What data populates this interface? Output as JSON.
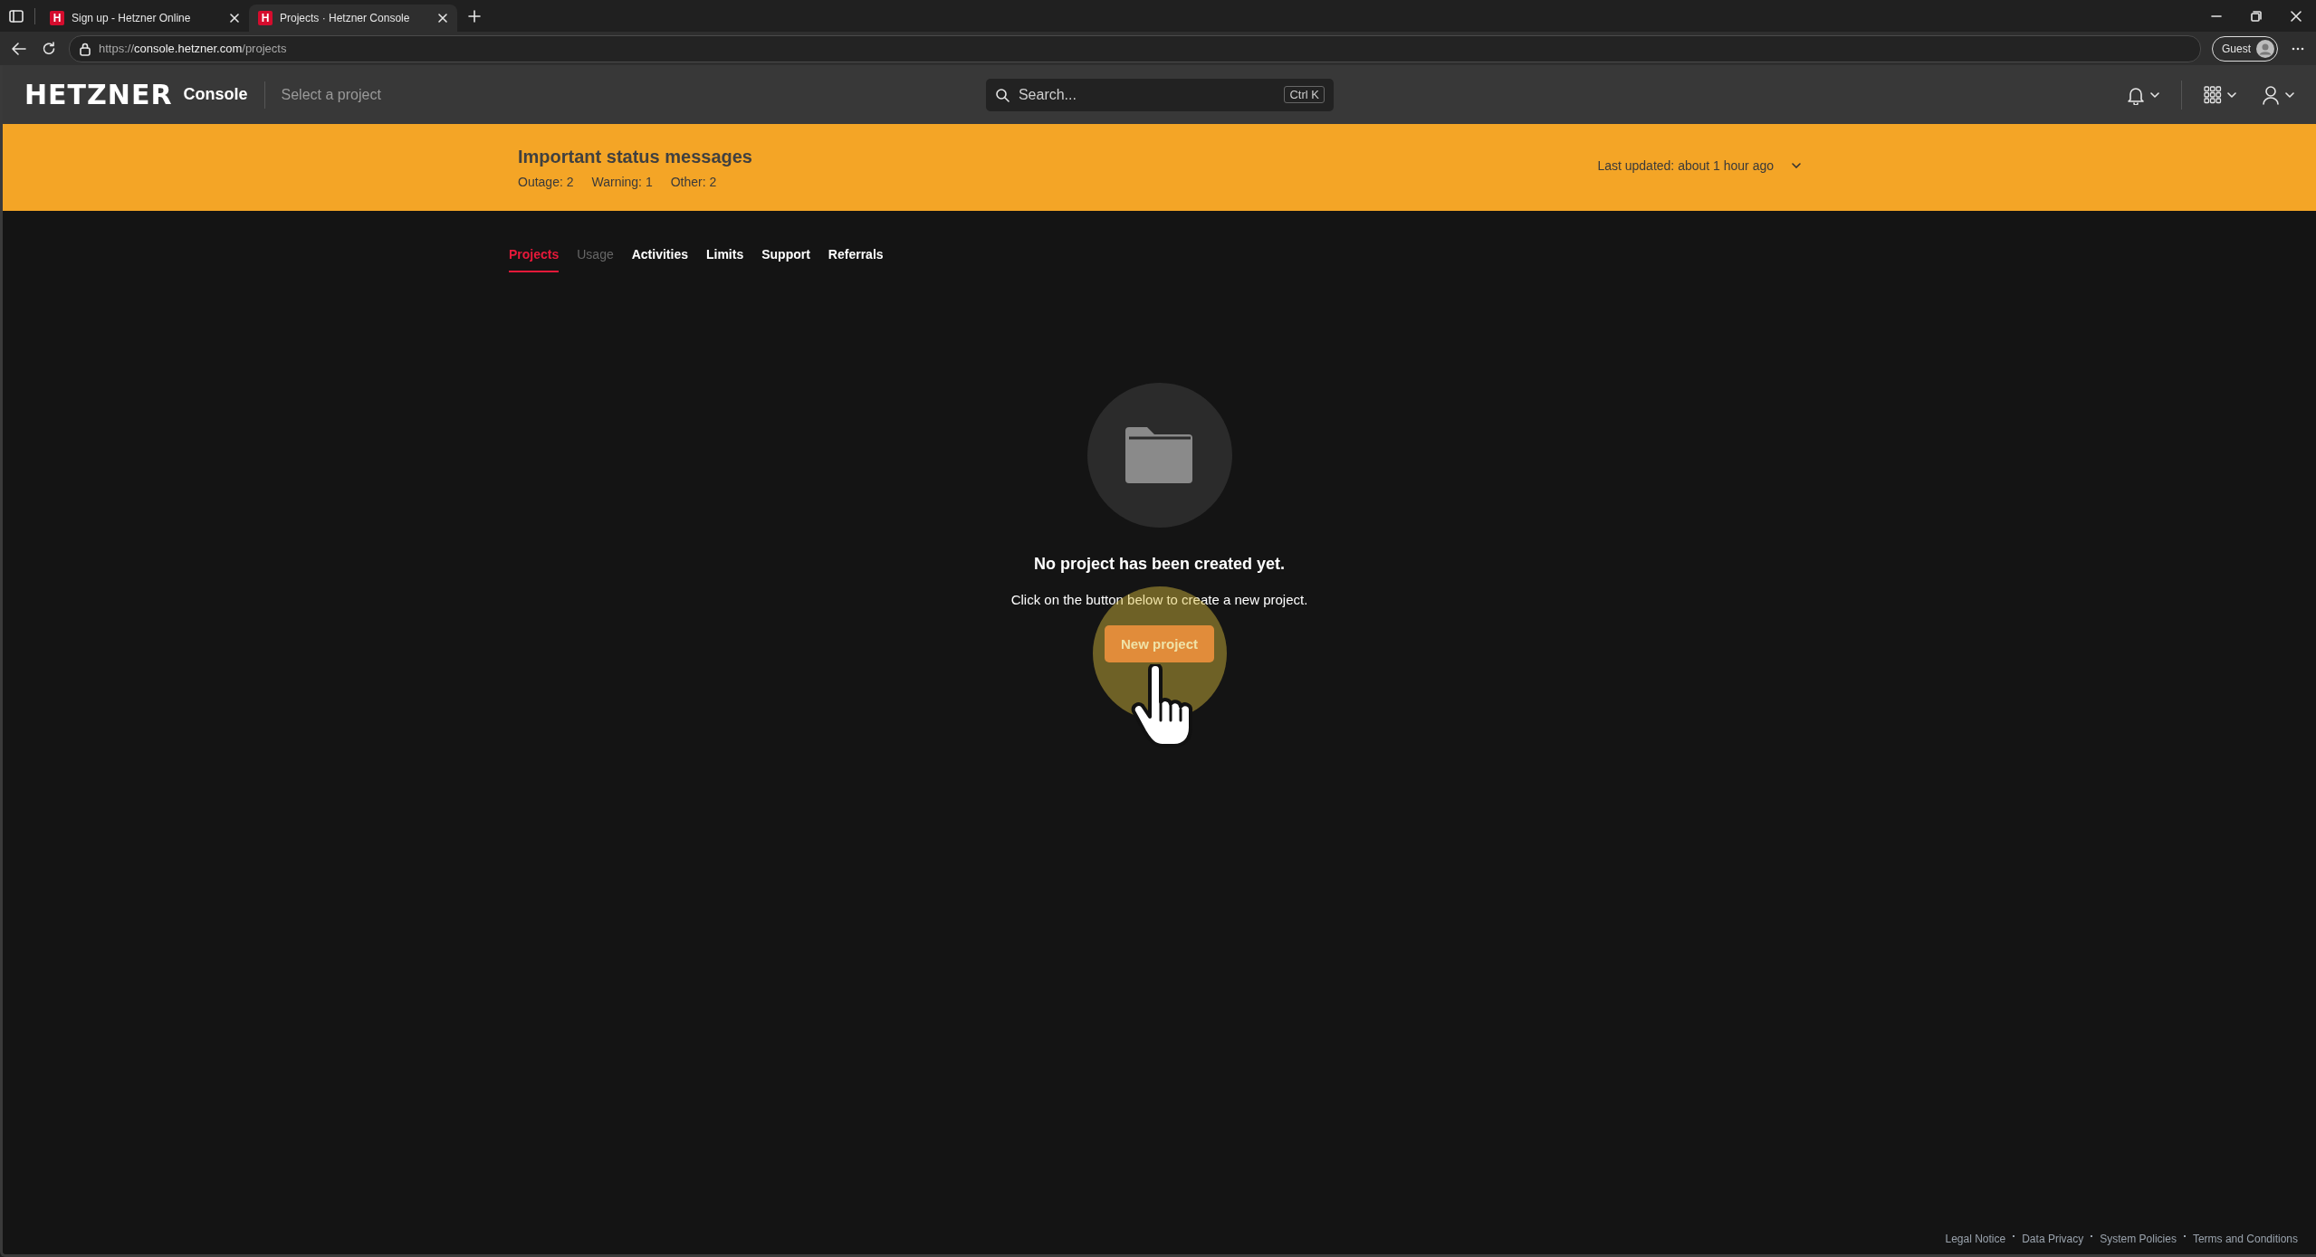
{
  "browser": {
    "tabs": [
      {
        "favicon": "H",
        "title": "Sign up - Hetzner Online",
        "selected": false
      },
      {
        "favicon": "H",
        "title": "Projects · Hetzner Console",
        "selected": true
      }
    ],
    "url": {
      "scheme": "https://",
      "host": "console.hetzner.com",
      "path": "/projects"
    },
    "profile": "Guest"
  },
  "header": {
    "logo": "HETZNER",
    "product": "Console",
    "project_selector": "Select a project",
    "search": {
      "placeholder": "Search...",
      "shortcut": "Ctrl K"
    }
  },
  "status_banner": {
    "title": "Important status messages",
    "counts": [
      {
        "label": "Outage:",
        "value": "2"
      },
      {
        "label": "Warning:",
        "value": "1"
      },
      {
        "label": "Other:",
        "value": "2"
      }
    ],
    "last_updated_label": "Last updated:",
    "last_updated_value": "about 1 hour ago"
  },
  "nav_tabs": [
    {
      "label": "Projects",
      "selected": true,
      "disabled": false
    },
    {
      "label": "Usage",
      "selected": false,
      "disabled": true
    },
    {
      "label": "Activities",
      "selected": false,
      "disabled": false
    },
    {
      "label": "Limits",
      "selected": false,
      "disabled": false
    },
    {
      "label": "Support",
      "selected": false,
      "disabled": false
    },
    {
      "label": "Referrals",
      "selected": false,
      "disabled": false
    }
  ],
  "empty_state": {
    "heading": "No project has been created yet.",
    "text": "Click on the button below to create a new project.",
    "button": "New project"
  },
  "pointer": {
    "click_highlight": true
  },
  "footer": {
    "links": [
      "Legal Notice",
      "Data Privacy",
      "System Policies",
      "Terms and Conditions"
    ]
  }
}
